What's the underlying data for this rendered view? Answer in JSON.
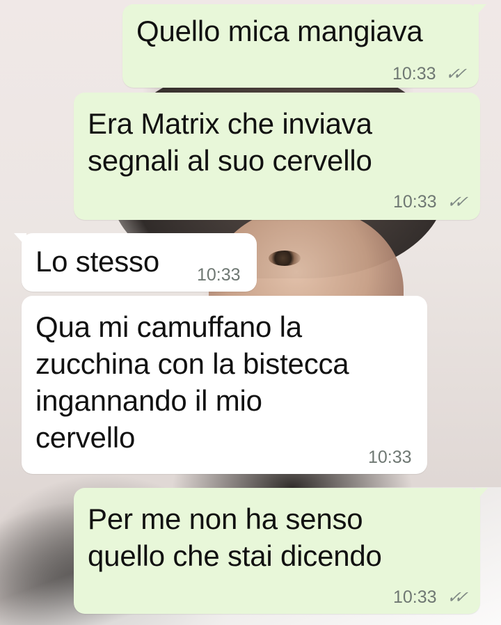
{
  "chat": {
    "messages": [
      {
        "direction": "outgoing",
        "text": "Quello mica mangiava",
        "time": "10:33",
        "status": "double-check-icon"
      },
      {
        "direction": "outgoing",
        "text": "Era Matrix che inviava\nsegnali al suo cervello",
        "time": "10:33",
        "status": "double-check-icon"
      },
      {
        "direction": "incoming",
        "text": "Lo stesso",
        "time": "10:33"
      },
      {
        "direction": "incoming",
        "text": "Qua mi camuffano la\nzucchina con la bistecca\ningannando il mio\ncervello",
        "time": "10:33"
      },
      {
        "direction": "outgoing",
        "text": "Per me non ha senso\nquello che stai dicendo",
        "time": "10:33",
        "status": "double-check-icon"
      }
    ]
  },
  "colors": {
    "outgoing_bubble": "#e8f7d9",
    "incoming_bubble": "#ffffff",
    "timestamp": "#6f7873"
  }
}
